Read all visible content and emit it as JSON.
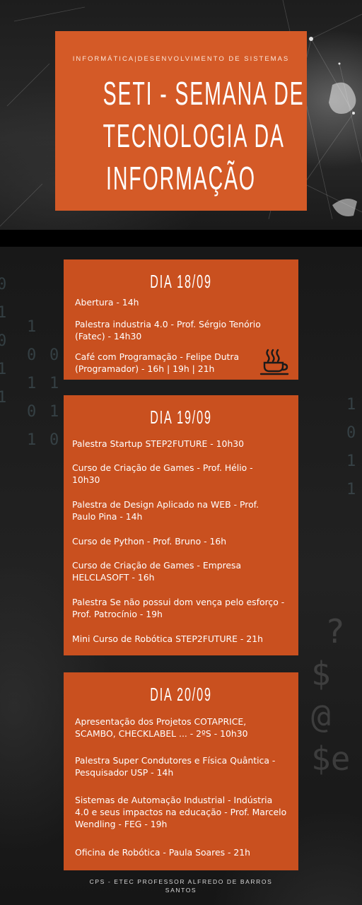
{
  "header": {
    "kicker": "INFORMÁTICA|DESENVOLVIMENTO DE SISTEMAS",
    "title_lines": [
      "SETI - SEMANA DE",
      "TECNOLOGIA DA",
      "INFORMAÇÃO"
    ]
  },
  "day1": {
    "title": "DIA 18/09",
    "items": [
      "Abertura - 14h",
      "Palestra industria 4.0 - Prof. Sérgio Tenório (Fatec) - 14h30",
      "Café com Programação - Felipe Dutra (Programador) - 16h | 19h | 21h"
    ],
    "icon": "coffee-cup-icon"
  },
  "day2": {
    "title": "DIA 19/09",
    "items": [
      "Palestra  Startup STEP2FUTURE - 10h30",
      "Curso de Criação de Games - Prof. Hélio - 10h30",
      "Palestra de Design Aplicado na WEB - Prof. Paulo Pina - 14h",
      "Curso de Python - Prof. Bruno - 16h",
      "Curso de Criação de Games - Empresa HELCLASOFT - 16h",
      "Palestra Se não possui dom vença pelo esforço - Prof. Patrocínio - 19h",
      "Mini Curso de Robótica STEP2FUTURE - 21h"
    ]
  },
  "day3": {
    "title": "DIA 20/09",
    "items": [
      "Apresentação dos Projetos COTAPRICE, SCAMBO, CHECKLABEL ... - 2ºS - 10h30",
      "Palestra Super Condutores e Física Quântica - Pesquisador USP - 14h",
      "Sistemas de Automação Industrial - Indústria 4.0 e seus impactos na educação - Prof. Marcelo Wendling - FEG - 19h",
      "Oficina de Robótica - Paula Soares - 21h"
    ]
  },
  "footer": {
    "line1": "CPS - ETEC PROFESSOR ALFREDO DE BARROS",
    "line2": "SANTOS"
  },
  "colors": {
    "accent": "#d45a27",
    "card": "#c9501f",
    "background": "#141414"
  }
}
